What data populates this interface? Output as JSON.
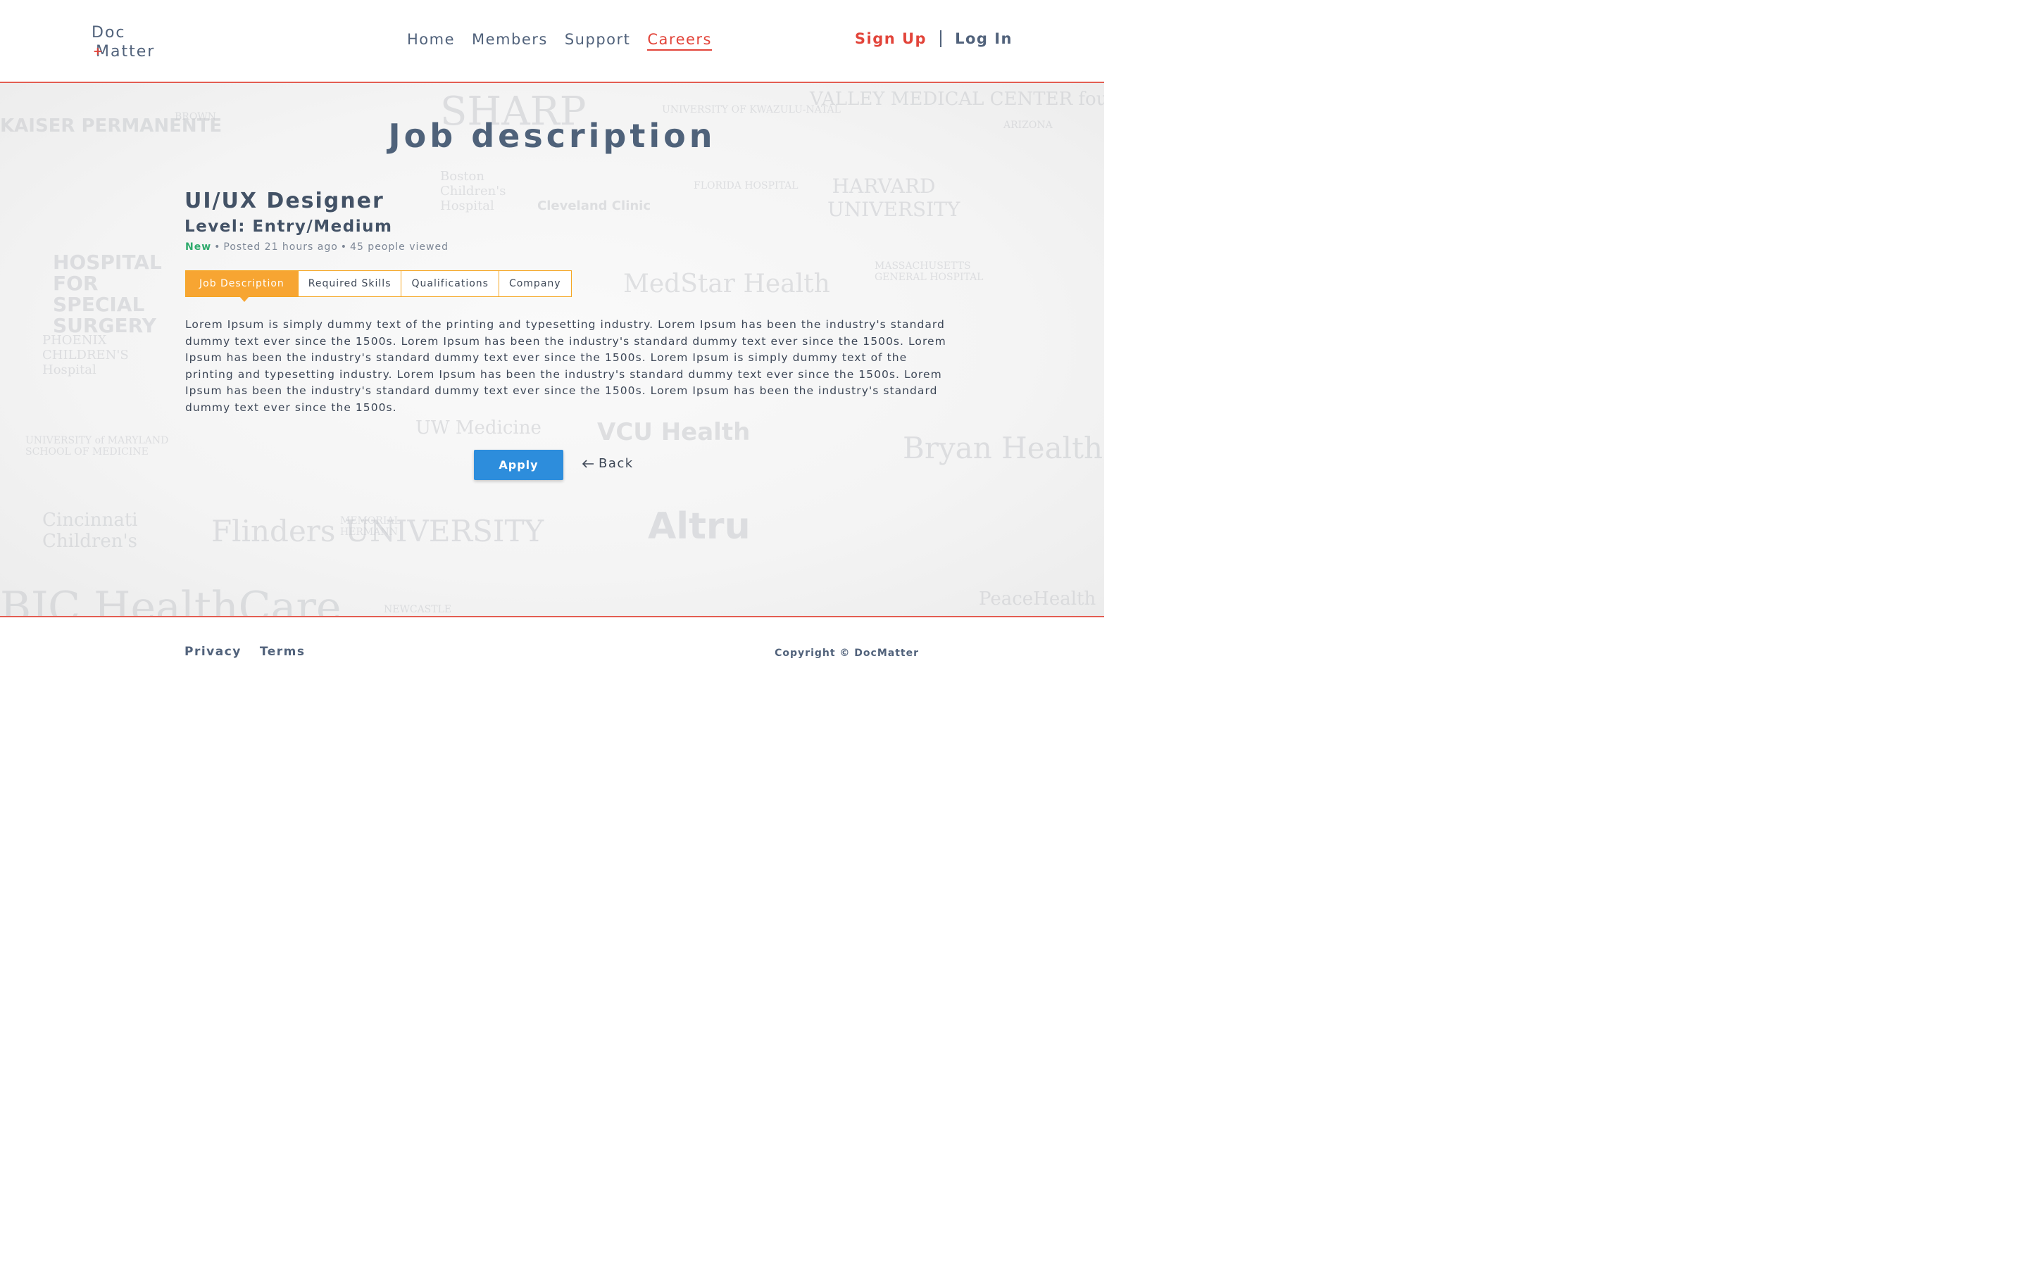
{
  "logo": {
    "line1": "Doc",
    "plus": "+",
    "line2": "Matter"
  },
  "nav": {
    "items": [
      {
        "label": "Home"
      },
      {
        "label": "Members"
      },
      {
        "label": "Support"
      },
      {
        "label": "Careers",
        "active": true
      }
    ]
  },
  "auth": {
    "signup": "Sign Up",
    "login": "Log In"
  },
  "background_logos": [
    "KAISER PERMANENTE",
    "BROWN",
    "SHARP",
    "UNIVERSITY OF KWAZULU-NATAL",
    "VALLEY MEDICAL CENTER foundation",
    "ARIZONA",
    "Boston Children's Hospital",
    "Cleveland Clinic",
    "FLORIDA HOSPITAL",
    "HARVARD UNIVERSITY",
    "HOSPITAL FOR SPECIAL SURGERY",
    "MedStar Health",
    "MASSACHUSETTS GENERAL HOSPITAL",
    "PHOENIX CHILDREN'S Hospital",
    "UNIVERSITY of MARYLAND SCHOOL OF MEDICINE",
    "UW Medicine",
    "VCU Health",
    "Bryan Health",
    "Cincinnati Children's",
    "Flinders UNIVERSITY",
    "MEMORIAL HERMANN",
    "Altru",
    "BJC HealthCare",
    "NEWCASTLE",
    "PeaceHealth"
  ],
  "main": {
    "title": "Job description",
    "job_title": "UI/UX Designer",
    "level": "Level: Entry/Medium",
    "meta": {
      "badge": "New",
      "posted": "Posted 21 hours ago",
      "views": "45 people viewed",
      "dot": "•"
    },
    "tabs": [
      {
        "label": "Job Description",
        "active": true
      },
      {
        "label": "Required Skills"
      },
      {
        "label": "Qualifications"
      },
      {
        "label": "Company"
      }
    ],
    "description": "Lorem Ipsum is simply dummy text of the printing and typesetting industry. Lorem Ipsum has been the industry's standard dummy text ever since the 1500s. Lorem Ipsum has been the industry's standard dummy text ever since the 1500s. Lorem Ipsum has been the industry's standard dummy text ever since the 1500s. Lorem Ipsum is simply dummy text of the printing and typesetting industry. Lorem Ipsum has been the industry's standard dummy text ever since the 1500s. Lorem Ipsum has been the industry's standard dummy text ever since the 1500s. Lorem Ipsum has been the industry's standard dummy text ever since the 1500s.",
    "apply_label": "Apply",
    "back_label": "Back"
  },
  "footer": {
    "privacy": "Privacy",
    "terms": "Terms",
    "copyright": "Copyright © DocMatter"
  },
  "colors": {
    "accent_red": "#e2443a",
    "tab_orange": "#f7a532",
    "apply_blue": "#2d8ddc",
    "new_green": "#2eaa6c",
    "text_slate": "#51627b"
  }
}
